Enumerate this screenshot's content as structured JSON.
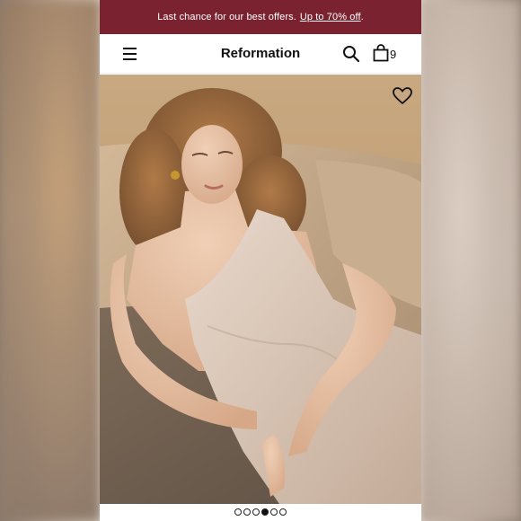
{
  "promo": {
    "text": "Last chance for our best offers.",
    "link": "Up to 70% off",
    "trailing": "."
  },
  "header": {
    "brand": "Reformation",
    "bag_count": "9",
    "icons": [
      "menu-icon",
      "search-icon",
      "shopping-bag-icon"
    ]
  },
  "hero": {
    "icons": [
      "heart-icon"
    ]
  },
  "carousel": {
    "dot_count": 6,
    "active_index": 3
  },
  "colors": {
    "promo_bg": "#7a2230",
    "text": "#111111",
    "hero_tone": "#c2a27c"
  }
}
